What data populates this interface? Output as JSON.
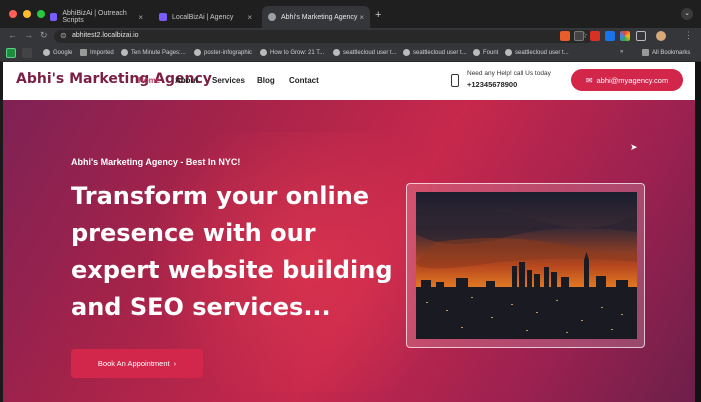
{
  "browser": {
    "tabs": [
      {
        "label": "AbhiBizAi | Outreach Scripts",
        "color": "#7a5cff"
      },
      {
        "label": "LocalBizAi | Agency",
        "color": "#7a5cff"
      },
      {
        "label": "Abhi's Marketing Agency",
        "color": "#9aa0a6"
      }
    ],
    "new_tab_glyph": "+",
    "url": "abhitest2.localbizai.io",
    "bookmarks": [
      "Google",
      "Imported",
      "Ten Minute Pages:...",
      "poster-infographic",
      "How to Grow: 21 T...",
      "seattlecloud user t...",
      "seattlecloud user t...",
      "Fount",
      "seattlecloud user t..."
    ],
    "more_glyph": "»",
    "all_bookmarks": "All Bookmarks"
  },
  "site": {
    "logo": "Abhi's Marketing Agency",
    "nav": [
      "Home",
      "About",
      "Services",
      "Blog",
      "Contact"
    ],
    "help_text": "Need any Help! call Us today",
    "phone": "+12345678900",
    "email_label": "abhi@myagency.com",
    "tagline": "Abhi's Marketing Agency - Best In NYC!",
    "headline": "Transform your online presence with our expert website building and SEO services...",
    "cta_label": "Book An Appointment",
    "cta_arrow": "›"
  },
  "colors": {
    "brand": "#d2264b",
    "logo": "#7b1f45"
  },
  "icons": [
    "back-icon",
    "forward-icon",
    "reload-icon",
    "lock-icon",
    "star-icon",
    "phone-icon",
    "mail-icon",
    "chevron-right-icon"
  ]
}
